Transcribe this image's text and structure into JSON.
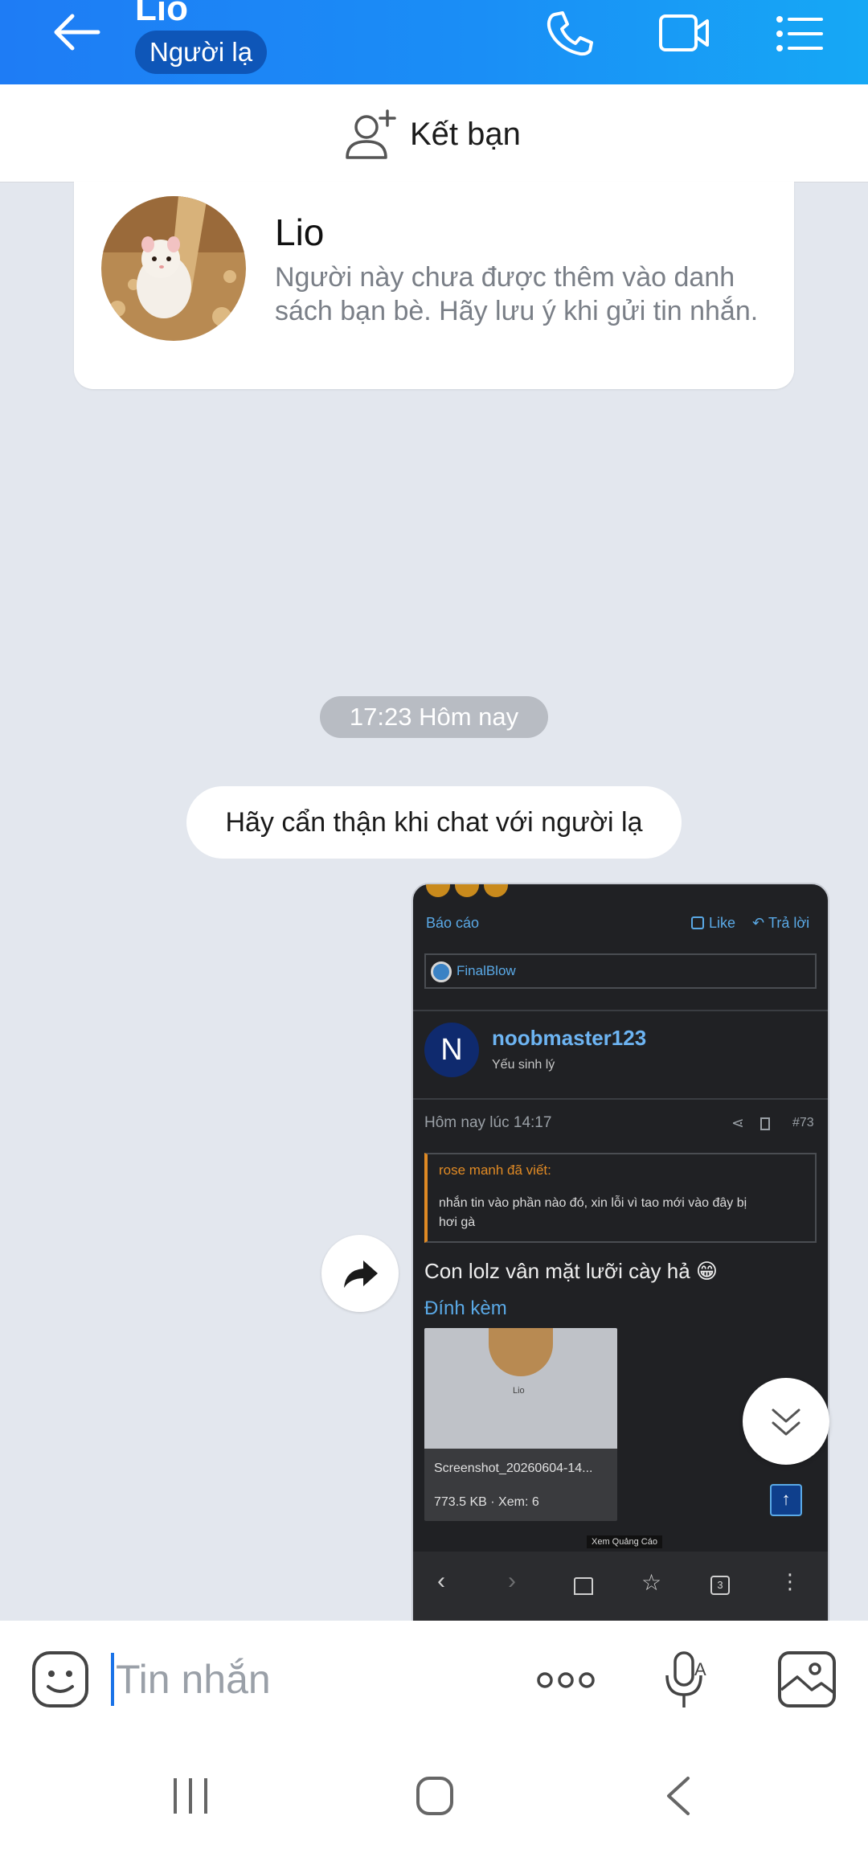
{
  "header": {
    "title": "Lio",
    "badge": "Người lạ",
    "icons": [
      "back-arrow-icon",
      "phone-icon",
      "video-call-icon",
      "list-menu-icon"
    ]
  },
  "add_friend": {
    "label": "Kết bạn",
    "icon": "add-user-icon"
  },
  "profile": {
    "name": "Lio",
    "description": "Người này chưa được thêm vào danh sách bạn bè. Hãy lưu ý khi gửi tin nhắn."
  },
  "timestamp": "17:23 Hôm nay",
  "system_message": "Hãy cẩn thận khi chat với người lạ",
  "image_message": {
    "report": "Báo cáo",
    "like": "Like",
    "reply": "Trả lời",
    "tag": "FinalBlow",
    "avatar_letter": "N",
    "username": "noobmaster123",
    "user_role": "Yếu sinh lý",
    "post_time": "Hôm nay lúc 14:17",
    "post_number": "#73",
    "quote_author": "rose manh đã viết:",
    "quote_text_1": "nhắn tin vào phần nào đó, xin lỗi vì tao mới vào đây bị",
    "quote_text_2": "hơi gà",
    "post_text": "Con lolz vân mặt lưỡi cày hả 😁",
    "attachment_label": "Đính kèm",
    "thumb_name": "Lio",
    "attachment_name": "Screenshot_20260604-14...",
    "attachment_meta": "773.5 KB · Xem: 6",
    "ad_label": "Xem Quảng Cáo",
    "tab_count": "3"
  },
  "input": {
    "placeholder": "Tin nhắn"
  },
  "colors": {
    "header_start": "#1e7cf5",
    "header_end": "#16a8f5",
    "badge": "#0e56b8",
    "background": "#e3e7ee"
  }
}
